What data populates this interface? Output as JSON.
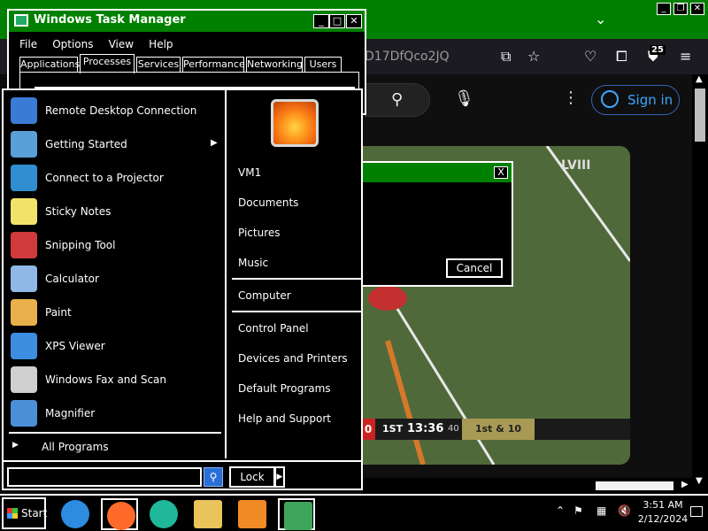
{
  "browser": {
    "url_fragment": "D17DfQco2JQ",
    "tab_badge": "25",
    "sign_in_label": "Sign in",
    "search_icon": "search-icon",
    "mic_icon": "mic-icon",
    "menu_icon": "hamburger-menu-icon"
  },
  "video": {
    "score_left": "0",
    "quarter": "1ST",
    "clock": "13:36",
    "play_clock": "40",
    "score_right": "1st & 10"
  },
  "dialog": {
    "cancel_label": "Cancel",
    "close_label": "X"
  },
  "taskmgr": {
    "title": "Windows Task Manager",
    "menu": [
      "File",
      "Options",
      "View",
      "Help"
    ],
    "tabs": [
      "Applications",
      "Processes",
      "Services",
      "Performance",
      "Networking",
      "Users"
    ],
    "active_tab": "Processes"
  },
  "startmenu": {
    "programs": [
      {
        "label": "Remote Desktop Connection",
        "icon": "remote-desktop-icon",
        "color": "#3a7bd5"
      },
      {
        "label": "Getting Started",
        "icon": "getting-started-icon",
        "color": "#5aa0d8",
        "submenu": true
      },
      {
        "label": "Connect to a Projector",
        "icon": "projector-icon",
        "color": "#2f8fd0"
      },
      {
        "label": "Sticky Notes",
        "icon": "sticky-notes-icon",
        "color": "#f2e26a"
      },
      {
        "label": "Snipping Tool",
        "icon": "scissors-icon",
        "color": "#d03a3a"
      },
      {
        "label": "Calculator",
        "icon": "calculator-icon",
        "color": "#8fb8e6"
      },
      {
        "label": "Paint",
        "icon": "paint-palette-icon",
        "color": "#e8b04a"
      },
      {
        "label": "XPS Viewer",
        "icon": "xps-viewer-icon",
        "color": "#3d8de0"
      },
      {
        "label": "Windows Fax and Scan",
        "icon": "fax-icon",
        "color": "#cfcfcf"
      },
      {
        "label": "Magnifier",
        "icon": "magnifier-icon",
        "color": "#4a90d9"
      }
    ],
    "all_programs": "All Programs",
    "right_links": [
      "VM1",
      "Documents",
      "Pictures",
      "Music",
      "Computer",
      "Control Panel",
      "Devices and Printers",
      "Default Programs",
      "Help and Support"
    ],
    "search_value": "",
    "lock_label": "Lock"
  },
  "taskbar": {
    "start_label": "Start",
    "apps": [
      {
        "icon": "internet-explorer-icon",
        "color": "#2d8be0"
      },
      {
        "icon": "firefox-icon",
        "color": "#ff6a2a"
      },
      {
        "icon": "edge-icon",
        "color": "#1fb89a"
      },
      {
        "icon": "file-explorer-icon",
        "color": "#e8c45a"
      },
      {
        "icon": "media-player-icon",
        "color": "#f08a24"
      },
      {
        "icon": "task-manager-icon",
        "color": "#3fa55a"
      }
    ],
    "time": "3:51 AM",
    "date": "2/12/2024"
  }
}
